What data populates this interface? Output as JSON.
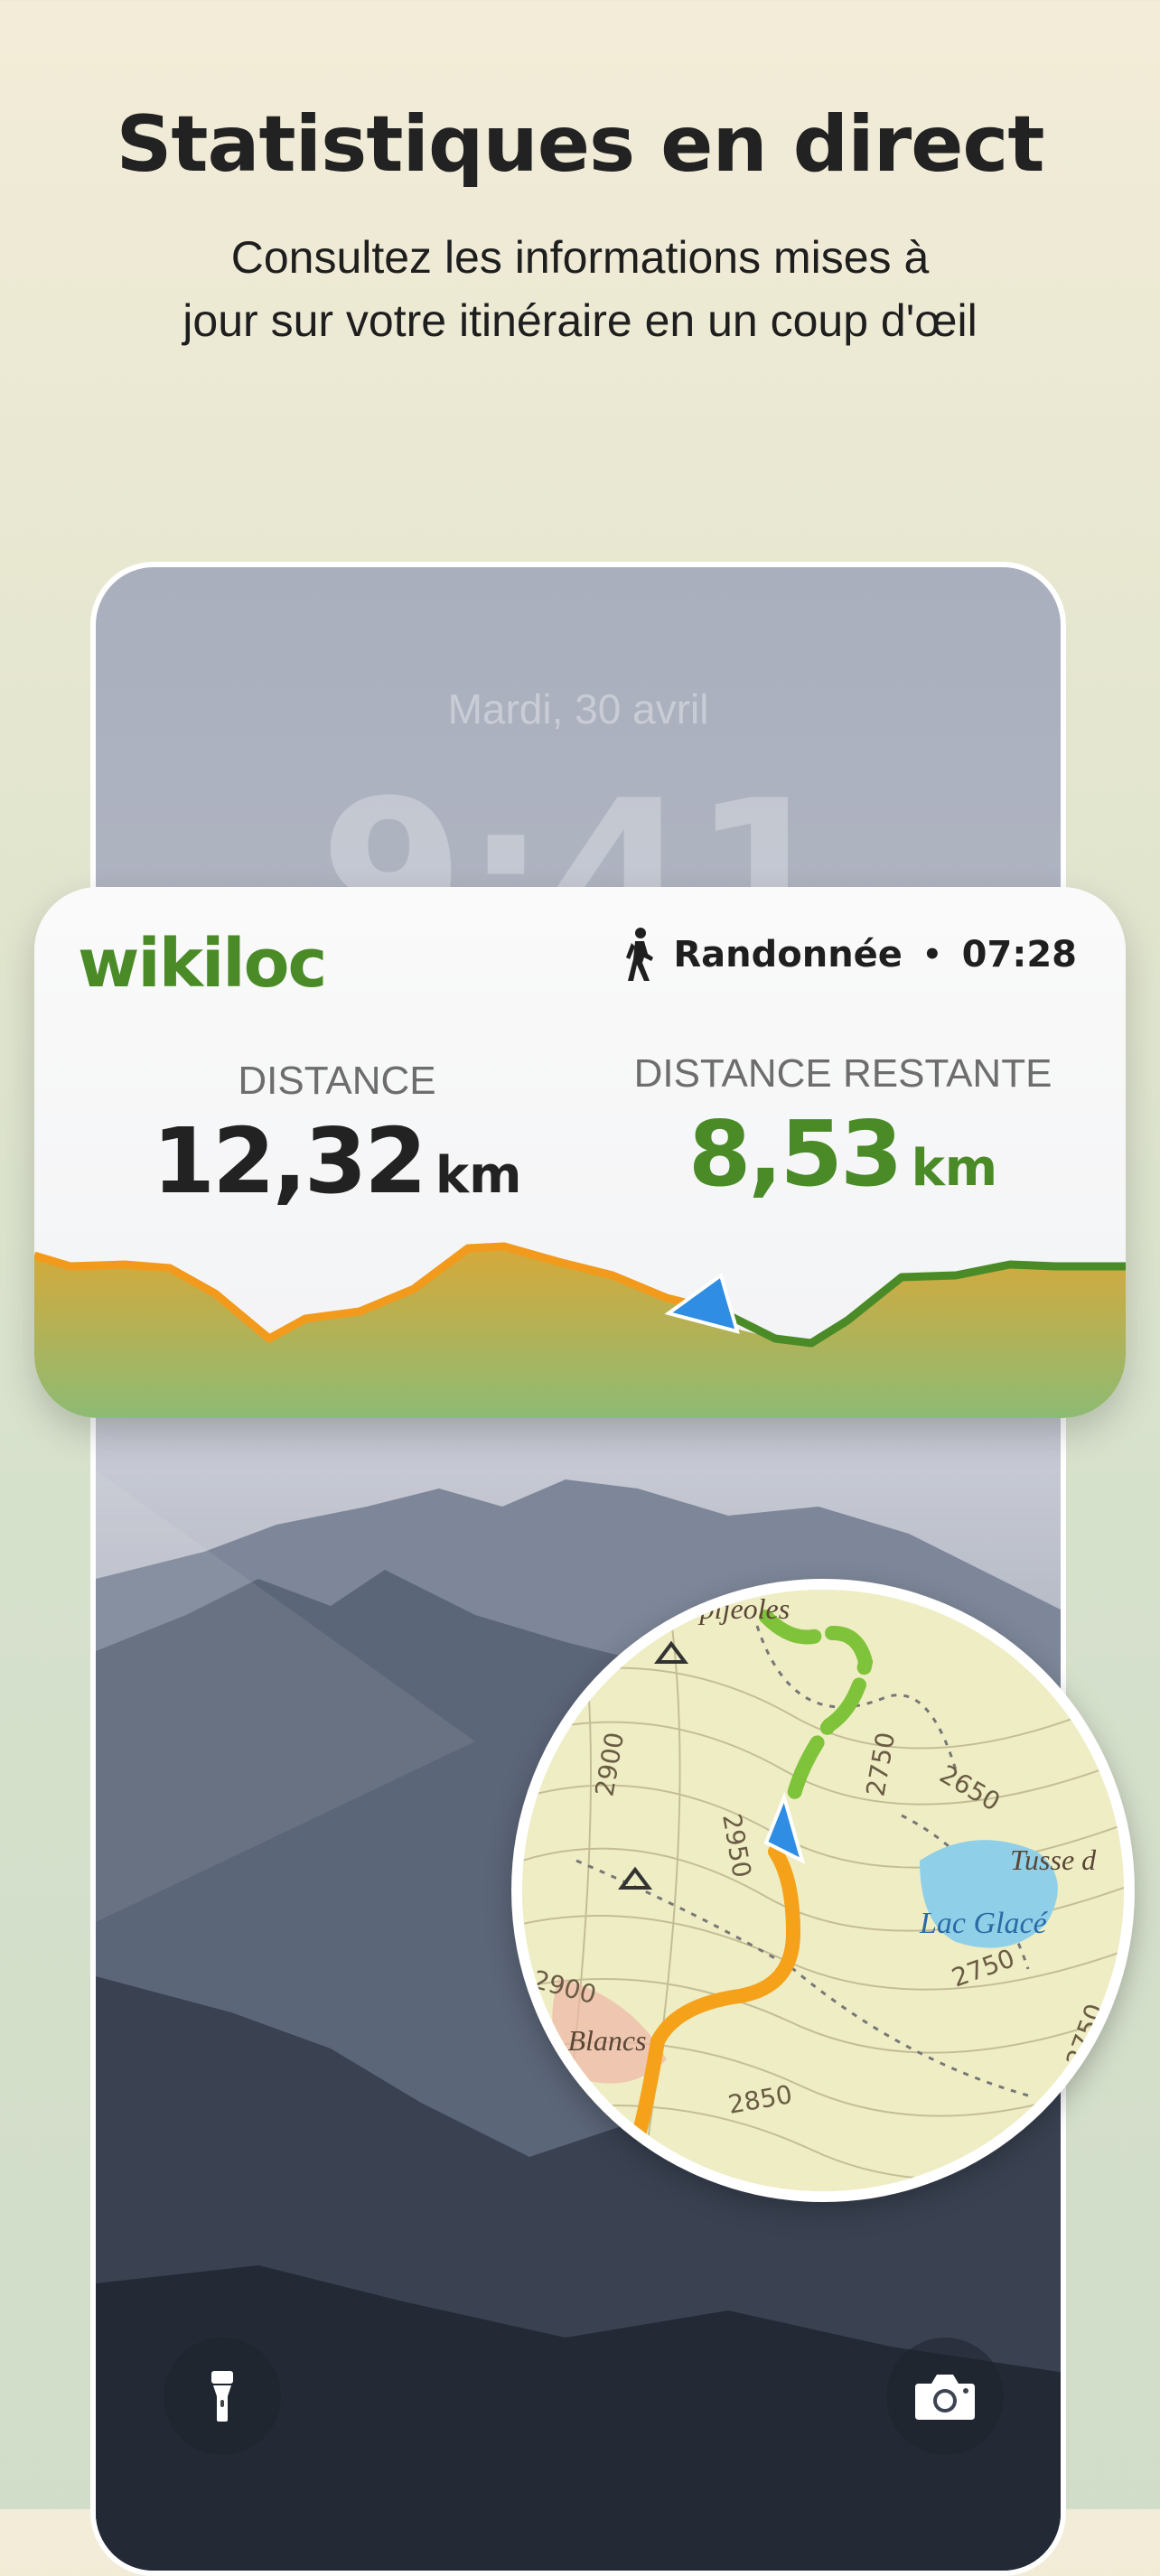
{
  "header": {
    "title": "Statistiques en direct",
    "subtitle_line1": "Consultez les informations mises à",
    "subtitle_line2": "jour sur votre itinéraire en un coup d'œil"
  },
  "lock_screen": {
    "date": "Mardi, 30 avril",
    "time": "9:41",
    "flashlight_icon": "flashlight-icon",
    "camera_icon": "camera-icon"
  },
  "widget": {
    "brand": "wikiloc",
    "activity_icon": "hiker-icon",
    "activity": "Randonnée",
    "separator": "•",
    "elapsed_time": "07:28",
    "distance": {
      "label": "DISTANCE",
      "value": "12,32",
      "unit": "km"
    },
    "remaining": {
      "label": "DISTANCE RESTANTE",
      "value": "8,53",
      "unit": "km"
    },
    "progress_fraction": 0.6,
    "colors": {
      "done": "#f29a1c",
      "remaining": "#4a8b27",
      "marker": "#2f8de4"
    }
  },
  "map": {
    "labels": {
      "peak_top": "ues Spijeoles",
      "lake": "Lac Glacé",
      "tusse": "Tusse d",
      "blancs": "s Blancs"
    },
    "elevations": [
      "2900",
      "2950",
      "2750",
      "2650",
      "2750",
      "2900",
      "2850",
      "2750"
    ],
    "route_colors": {
      "done": "#f5a21a",
      "remaining": "#7fc33a",
      "water": "#8fd0e8"
    }
  }
}
